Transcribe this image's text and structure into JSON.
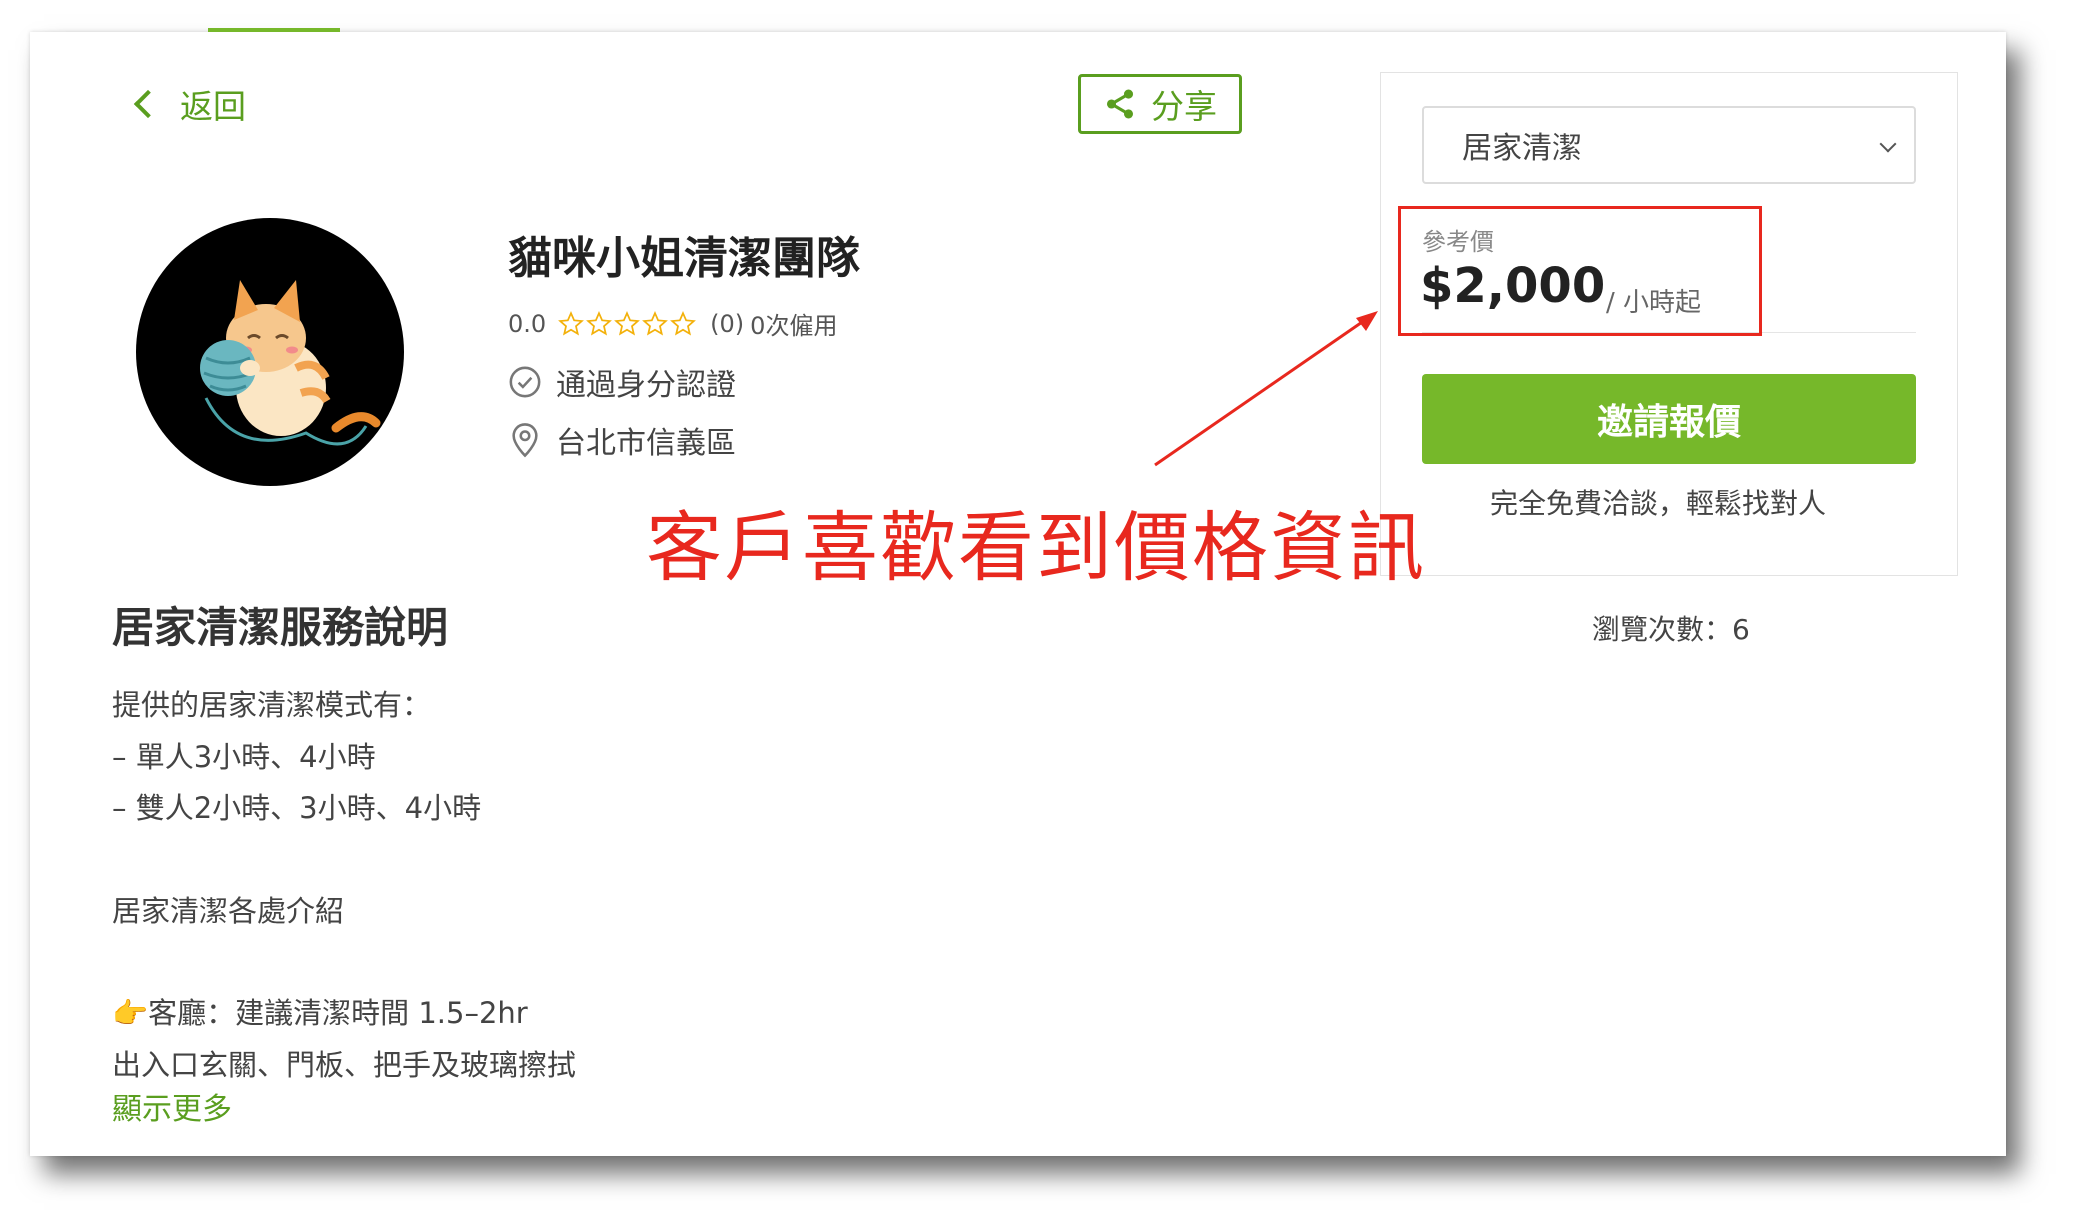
{
  "nav": {
    "back_label": "返回",
    "share_label": "分享"
  },
  "provider": {
    "name": "貓咪小姐清潔團隊",
    "rating": "0.0",
    "stars_filled": 0,
    "stars_total": 5,
    "review_count": "(0)",
    "hire_count": "0次僱用",
    "verified_text": "通過身分認證",
    "location": "台北市信義區"
  },
  "description": {
    "title": "居家清潔服務說明",
    "lines": [
      "提供的居家清潔模式有：",
      "– 單人3小時、4小時",
      "– 雙人2小時、3小時、4小時",
      "",
      "居家清潔各處介紹",
      "",
      "👉客廳：建議清潔時間 1.5–2hr",
      "出入口玄關、門板、把手及玻璃擦拭"
    ],
    "show_more": "顯示更多"
  },
  "pricing": {
    "service_select": "居家清潔",
    "price_label": "參考價",
    "price_value": "$2,000",
    "price_unit": "/ 小時起",
    "invite_button": "邀請報價",
    "invite_note": "完全免費洽談，輕鬆找對人",
    "view_count": "瀏覽次數：6"
  },
  "annotation": {
    "text": "客戶喜歡看到價格資訊"
  },
  "colors": {
    "brand_green": "#76b82a",
    "link_green": "#5a9e1f",
    "annotation_red": "#e8281e",
    "star": "#f3b10b"
  }
}
